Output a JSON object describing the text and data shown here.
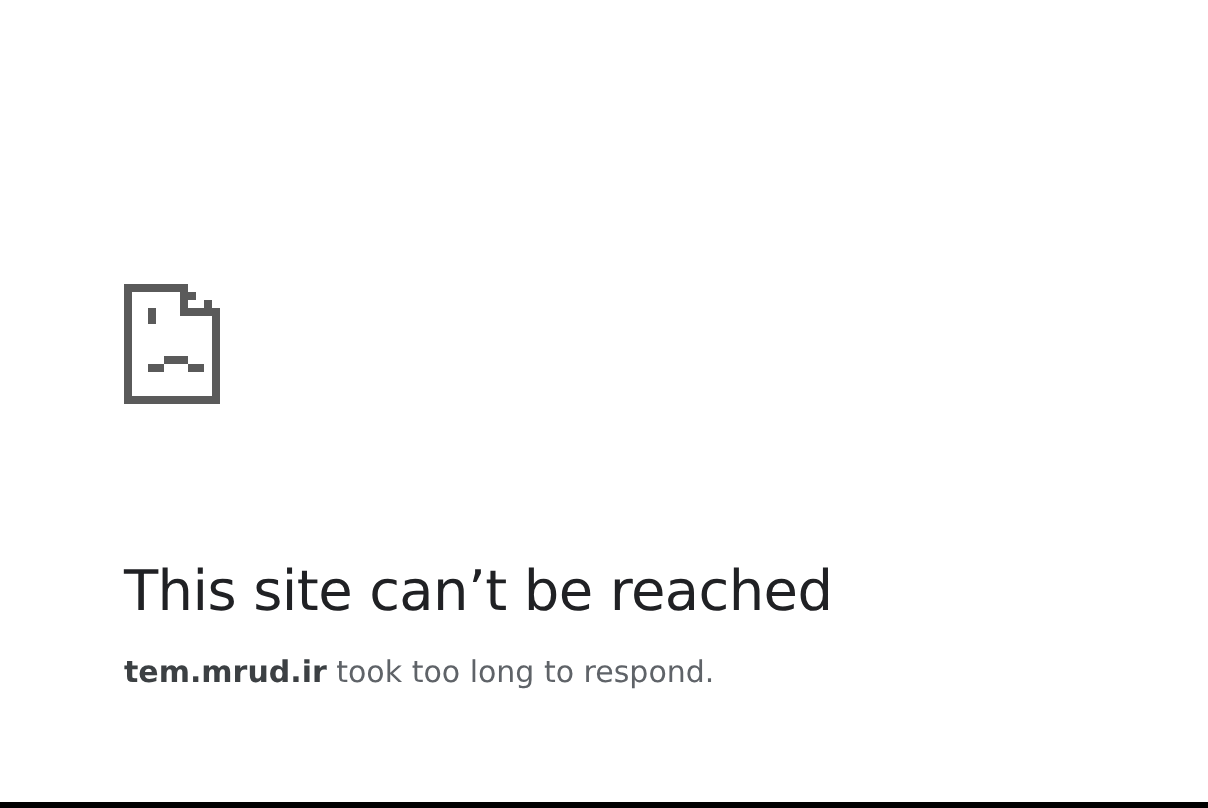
{
  "error": {
    "title": "This site can’t be reached",
    "message": "**tem.mrud.ir** took too long to respond."
  }
}
